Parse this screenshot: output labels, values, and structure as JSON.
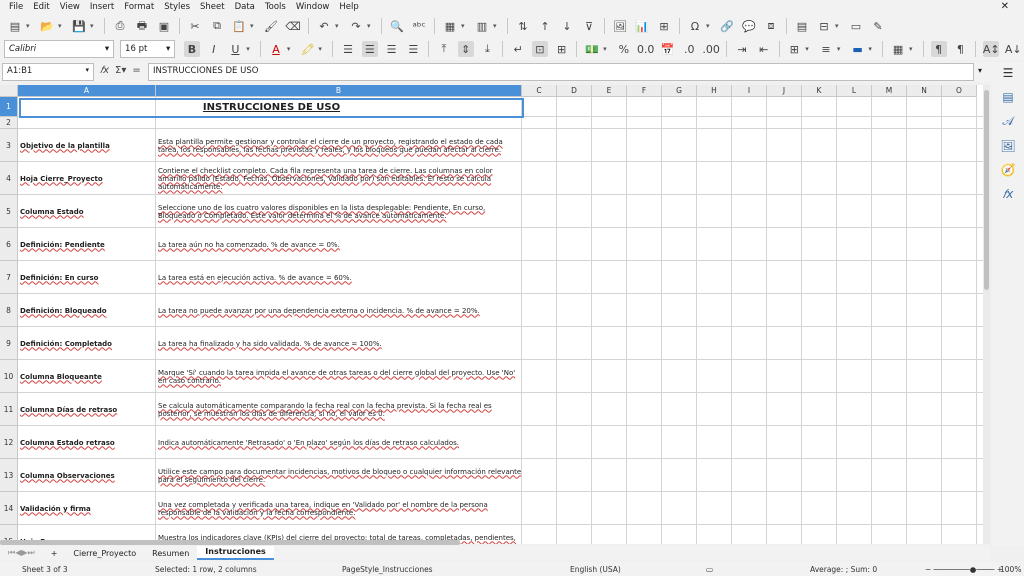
{
  "menu": [
    "File",
    "Edit",
    "View",
    "Insert",
    "Format",
    "Styles",
    "Sheet",
    "Data",
    "Tools",
    "Window",
    "Help"
  ],
  "menu_close": "✕",
  "font": {
    "name": "Calibri",
    "size": "16 pt"
  },
  "namebox": "A1:B1",
  "formula": "INSTRUCCIONES DE USO",
  "columns": [
    "A",
    "B",
    "C",
    "D",
    "E",
    "F",
    "G",
    "H",
    "I",
    "J",
    "K",
    "L",
    "M",
    "N",
    "O"
  ],
  "title": "INSTRUCCIONES DE USO",
  "rows": [
    {
      "num": "1",
      "a": "",
      "b": ""
    },
    {
      "num": "2",
      "a": "",
      "b": ""
    },
    {
      "num": "3",
      "a": "Objetivo de la plantilla",
      "b": "Esta plantilla permite gestionar y controlar el cierre de un proyecto, registrando el estado de cada tarea, los responsables, las fechas previstas y reales, y los bloqueos que puedan afectar al cierre."
    },
    {
      "num": "4",
      "a": "Hoja Cierre_Proyecto",
      "b": "Contiene el checklist completo. Cada fila representa una tarea de cierre. Las columnas en color amarillo pálido (Estado, Fechas, Observaciones, Validado por) son editables. El resto se calcula automáticamente."
    },
    {
      "num": "5",
      "a": "Columna Estado",
      "b": "Seleccione uno de los cuatro valores disponibles en la lista desplegable: Pendiente, En curso, Bloqueado o Completado. Este valor determina el % de avance automáticamente."
    },
    {
      "num": "6",
      "a": "Definición: Pendiente",
      "b": "La tarea aún no ha comenzado. % de avance = 0%."
    },
    {
      "num": "7",
      "a": "Definición: En curso",
      "b": "La tarea está en ejecución activa. % de avance = 60%."
    },
    {
      "num": "8",
      "a": "Definición: Bloqueado",
      "b": "La tarea no puede avanzar por una dependencia externa o incidencia. % de avance = 20%."
    },
    {
      "num": "9",
      "a": "Definición: Completado",
      "b": "La tarea ha finalizado y ha sido validada. % de avance = 100%."
    },
    {
      "num": "10",
      "a": "Columna Bloqueante",
      "b": "Marque 'Sí' cuando la tarea impida el avance de otras tareas o del cierre global del proyecto. Use 'No' en caso contrario."
    },
    {
      "num": "11",
      "a": "Columna Días de retraso",
      "b": "Se calcula automáticamente comparando la fecha real con la fecha prevista. Si la fecha real es posterior, se muestran los días de diferencia; si no, el valor es 0."
    },
    {
      "num": "12",
      "a": "Columna Estado retraso",
      "b": "Indica automáticamente 'Retrasado' o 'En plazo' según los días de retraso calculados."
    },
    {
      "num": "13",
      "a": "Columna Observaciones",
      "b": "Utilice este campo para documentar incidencias, motivos de bloqueo o cualquier información relevante para el seguimiento del cierre."
    },
    {
      "num": "14",
      "a": "Validación y firma",
      "b": "Una vez completada y verificada una tarea, indique en 'Validado por' el nombre de la persona responsable de la validación y la fecha correspondiente."
    },
    {
      "num": "15",
      "a": "Hoja Resumen",
      "b": "Muestra los indicadores clave (KPIs) del cierre del proyecto: total de tareas, completadas, pendientes, bloqueadas, % de"
    }
  ],
  "tabs": [
    "Cierre_Proyecto",
    "Resumen",
    "Instrucciones"
  ],
  "tab_add": "+",
  "status": {
    "sheet": "Sheet 3 of 3",
    "selected": "Selected: 1 row, 2 columns",
    "pagestyle": "PageStyle_Instrucciones",
    "lang": "English (USA)",
    "avg": "Average: ; Sum: 0",
    "zoom": "100%"
  }
}
